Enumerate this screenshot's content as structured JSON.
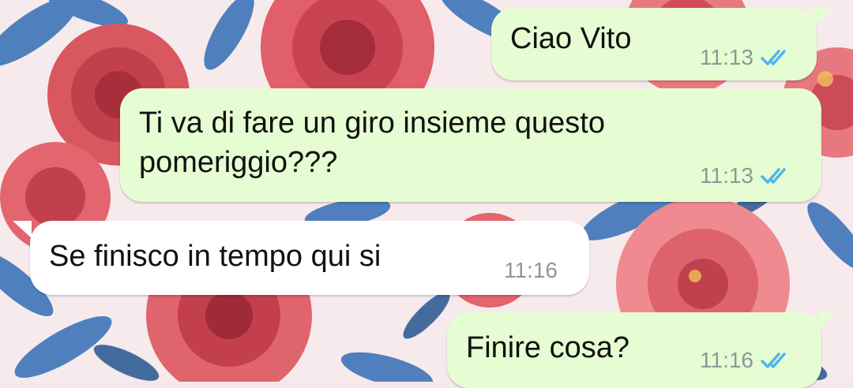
{
  "chat": {
    "wallpaper": "floral-pattern",
    "colors": {
      "outgoing_bubble": "#e6fcd2",
      "incoming_bubble": "#ffffff",
      "read_ticks": "#4fb6ec",
      "timestamp": "#8b9a95"
    },
    "messages": [
      {
        "direction": "outgoing",
        "text": "Ciao Vito",
        "time": "11:13",
        "status": "read",
        "status_icon": "double-check-icon"
      },
      {
        "direction": "outgoing",
        "text": "Ti va di fare un giro insieme questo\npomeriggio???",
        "time": "11:13",
        "status": "read",
        "status_icon": "double-check-icon"
      },
      {
        "direction": "incoming",
        "text": "Se finisco in tempo qui si",
        "time": "11:16"
      },
      {
        "direction": "outgoing",
        "text": "Finire cosa?",
        "time": "11:16",
        "status": "read",
        "status_icon": "double-check-icon"
      }
    ]
  }
}
